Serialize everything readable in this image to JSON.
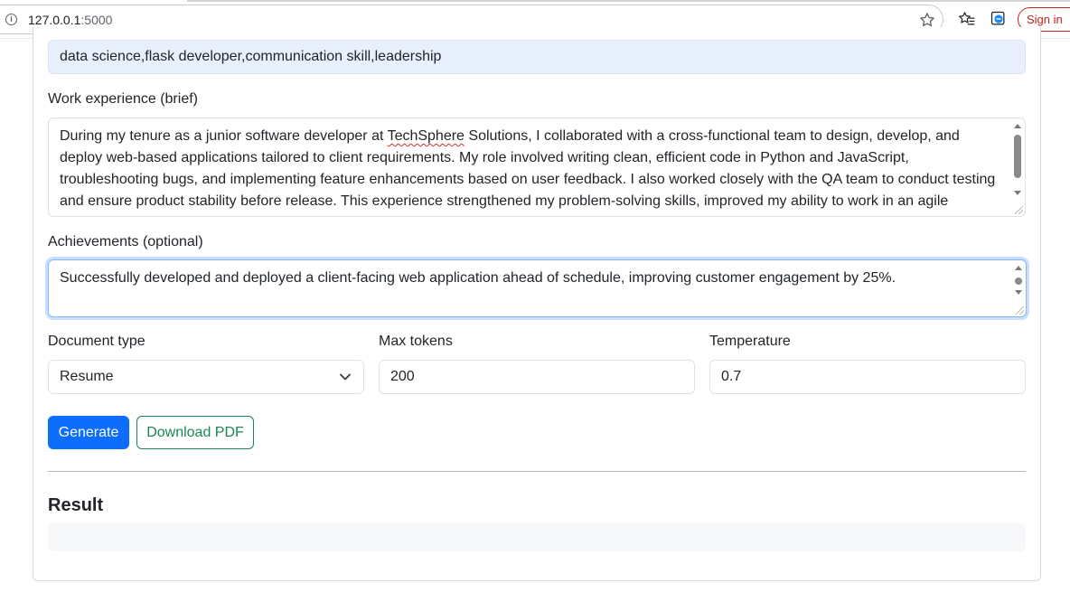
{
  "browser": {
    "url_host": "127.0.0.1",
    "url_port": ":5000",
    "signin_label": "Sign in"
  },
  "form": {
    "skills_value": "data science,flask developer,communication skill,leadership",
    "work_label": "Work experience (brief)",
    "work_value_pre": "During my tenure as a junior software developer at ",
    "work_value_misspelled": "TechSphere",
    "work_value_post": " Solutions, I collaborated with a cross-functional team to design, develop, and deploy web-based applications tailored to client requirements. My role involved writing clean, efficient code in Python and JavaScript, troubleshooting bugs, and implementing feature enhancements based on user feedback. I also worked closely with the QA team to conduct testing and ensure product stability before release. This experience strengthened my problem-solving skills, improved my ability to work in an agile",
    "achievements_label": "Achievements (optional)",
    "achievements_value": "Successfully developed and deployed a client-facing web application ahead of schedule, improving customer engagement by 25%.",
    "doc_type_label": "Document type",
    "doc_type_value": "Resume",
    "max_tokens_label": "Max tokens",
    "max_tokens_value": "200",
    "temperature_label": "Temperature",
    "temperature_value": "0.7"
  },
  "actions": {
    "generate_label": "Generate",
    "download_label": "Download PDF"
  },
  "result": {
    "title": "Result",
    "content": ""
  },
  "colors": {
    "primary": "#0d6efd",
    "success": "#198754",
    "autofill_bg": "#e8f0fe",
    "focus_border": "#86b7fe",
    "signin": "#c5221f"
  }
}
